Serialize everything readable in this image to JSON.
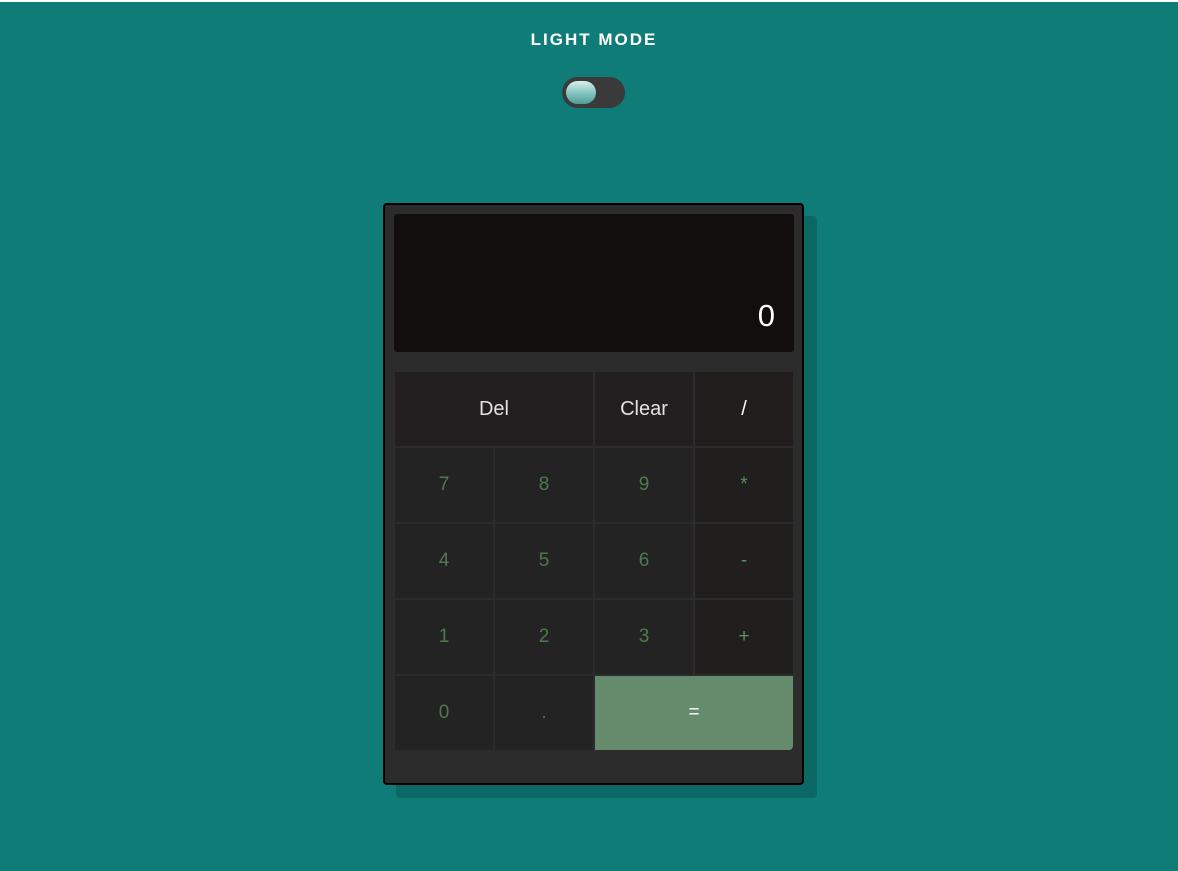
{
  "theme_toggle": {
    "label": "LIGHT MODE",
    "state": "off"
  },
  "calculator": {
    "display": {
      "value": "0"
    },
    "keys": [
      {
        "label": "Del",
        "name": "delete-key",
        "kind": "fn"
      },
      {
        "label": "Clear",
        "name": "clear-key",
        "kind": "fn"
      },
      {
        "label": "/",
        "name": "divide-key",
        "kind": "fn"
      },
      {
        "label": "7",
        "name": "digit-7-key",
        "kind": "num"
      },
      {
        "label": "8",
        "name": "digit-8-key",
        "kind": "num"
      },
      {
        "label": "9",
        "name": "digit-9-key",
        "kind": "num"
      },
      {
        "label": "*",
        "name": "multiply-key",
        "kind": "op"
      },
      {
        "label": "4",
        "name": "digit-4-key",
        "kind": "num"
      },
      {
        "label": "5",
        "name": "digit-5-key",
        "kind": "num"
      },
      {
        "label": "6",
        "name": "digit-6-key",
        "kind": "num"
      },
      {
        "label": "-",
        "name": "subtract-key",
        "kind": "op"
      },
      {
        "label": "1",
        "name": "digit-1-key",
        "kind": "num"
      },
      {
        "label": "2",
        "name": "digit-2-key",
        "kind": "num"
      },
      {
        "label": "3",
        "name": "digit-3-key",
        "kind": "num"
      },
      {
        "label": "+",
        "name": "add-key",
        "kind": "op"
      },
      {
        "label": "0",
        "name": "digit-0-key",
        "kind": "num"
      },
      {
        "label": ".",
        "name": "decimal-key",
        "kind": "num"
      },
      {
        "label": "=",
        "name": "equals-key",
        "kind": "equals"
      }
    ]
  },
  "colors": {
    "page_background": "#0f7c78",
    "calculator_body": "#2d2c2c",
    "display_background": "#120e0d",
    "digit_text": "#4f7a4d",
    "equals_background": "#668a6c"
  }
}
